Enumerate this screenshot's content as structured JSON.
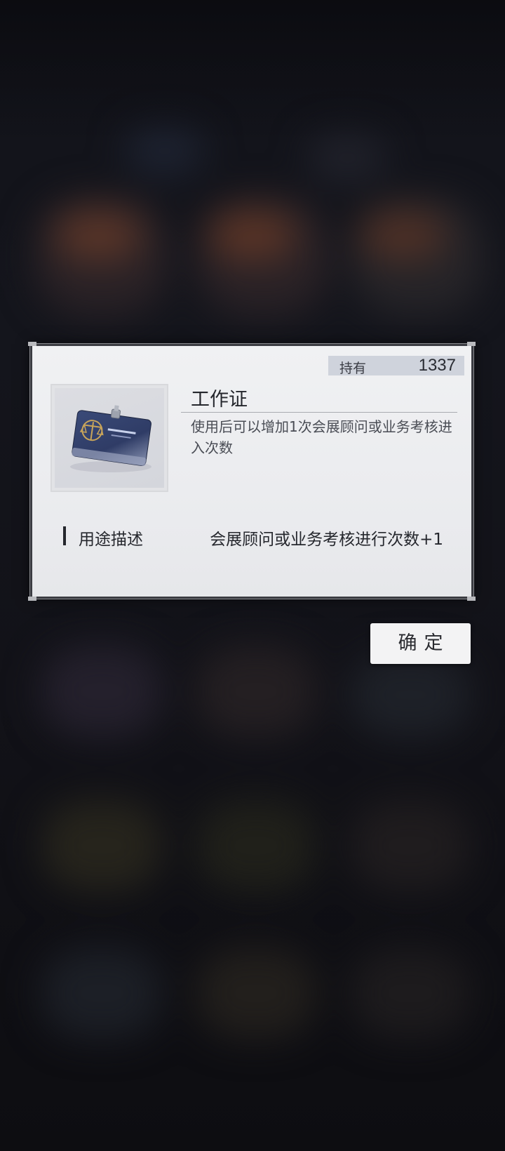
{
  "dialog": {
    "owned_label": "持有",
    "owned_count": "1337",
    "item_name": "工作证",
    "item_icon": "work-badge-icon",
    "item_description": "使用后可以增加1次会展顾问或业务考核进入次数",
    "usage_label": "用途描述",
    "usage_value": "会展顾问或业务考核进行次数+1"
  },
  "confirm_button": {
    "label": "确定"
  },
  "colors": {
    "dialog_bg": "#eeeff1",
    "dialog_border": "#3b3c42",
    "owned_bar": "#cfd3dc",
    "backdrop": "#121218"
  }
}
